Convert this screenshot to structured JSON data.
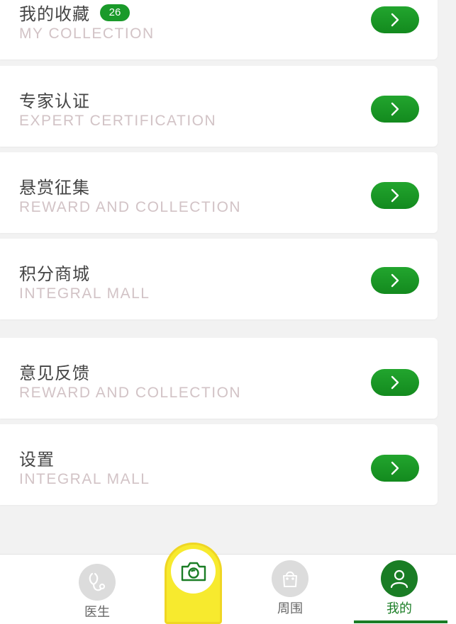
{
  "menu": [
    {
      "title": "我的收藏",
      "subtitle": "MY COLLECTION",
      "badge": "26"
    },
    {
      "title": "专家认证",
      "subtitle": "EXPERT CERTIFICATION"
    },
    {
      "title": "悬赏征集",
      "subtitle": "REWARD AND COLLECTION"
    },
    {
      "title": "积分商城",
      "subtitle": "INTEGRAL MALL"
    },
    {
      "title": "意见反馈",
      "subtitle": "REWARD AND COLLECTION"
    },
    {
      "title": "设置",
      "subtitle": "INTEGRAL MALL"
    }
  ],
  "nav": {
    "doctor": "医生",
    "nearby": "周围",
    "mine": "我的"
  },
  "colors": {
    "accent": "#1a9a2a",
    "camera": "#f7ea2e",
    "subtitle": "#d2c3c6"
  },
  "icons": {
    "arrow": "chevron-right-icon",
    "camera": "camera-icon",
    "doctor": "stethoscope-icon",
    "nearby": "shopping-bag-icon",
    "mine": "user-icon"
  }
}
